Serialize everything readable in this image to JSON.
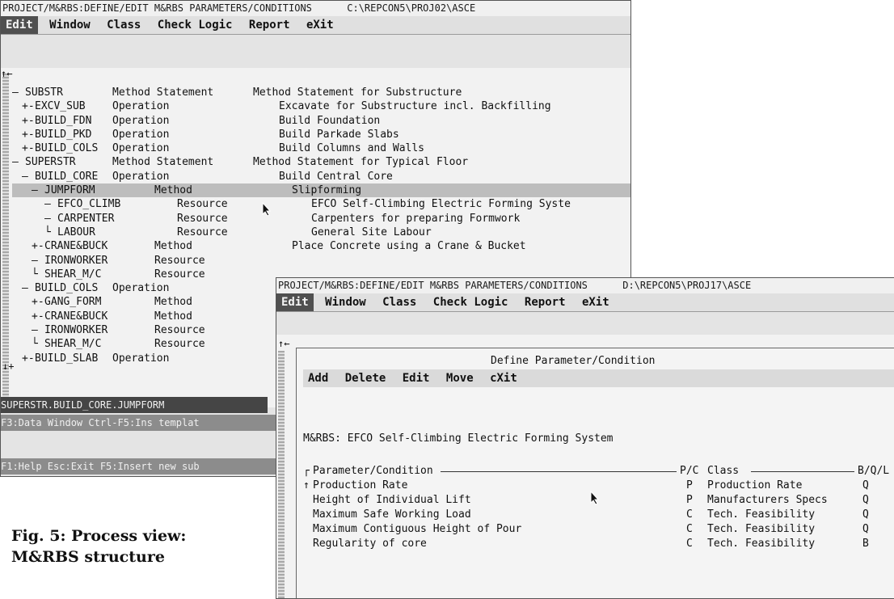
{
  "window1": {
    "title": "PROJECT/M&RBS:DEFINE/EDIT M&RBS PARAMETERS/CONDITIONS      C:\\REPCON5\\PROJ02\\ASCE",
    "menu": [
      "Edit",
      "Window",
      "Class",
      "Check Logic",
      "Report",
      "eXit"
    ],
    "tree_marker": "↑←",
    "tree_rows": [
      {
        "prefix": "—",
        "code": "SUBSTR",
        "type": "Method Statement",
        "desc": "Method Statement for Substructure",
        "indent": 0
      },
      {
        "prefix": "+-",
        "code": "EXCV_SUB",
        "type": "Operation",
        "desc": "Excavate for Substructure incl. Backfilling",
        "indent": 1
      },
      {
        "prefix": "+-",
        "code": "BUILD_FDN",
        "type": "Operation",
        "desc": "Build Foundation",
        "indent": 1
      },
      {
        "prefix": "+-",
        "code": "BUILD_PKD",
        "type": "Operation",
        "desc": "Build Parkade Slabs",
        "indent": 1
      },
      {
        "prefix": "+-",
        "code": "BUILD_COLS",
        "type": "Operation",
        "desc": "Build Columns and Walls",
        "indent": 1
      },
      {
        "prefix": "—",
        "code": "SUPERSTR",
        "type": "Method Statement",
        "desc": "Method Statement for Typical Floor",
        "indent": 0
      },
      {
        "prefix": "—",
        "code": "BUILD_CORE",
        "type": "Operation",
        "desc": "Build Central Core",
        "indent": 1
      },
      {
        "prefix": "—",
        "code": "JUMPFORM",
        "type": "Method",
        "desc": "Slipforming",
        "indent": 2,
        "highlight": true
      },
      {
        "prefix": "—",
        "code": "EFCO_CLIMB",
        "type": "Resource",
        "desc": "EFCO Self-Climbing Electric Forming Syste",
        "indent": 3
      },
      {
        "prefix": "—",
        "code": "CARPENTER",
        "type": "Resource",
        "desc": "Carpenters for preparing Formwork",
        "indent": 3
      },
      {
        "prefix": "└",
        "code": "LABOUR",
        "type": "Resource",
        "desc": "General Site Labour",
        "indent": 3
      },
      {
        "prefix": "+-",
        "code": "CRANE&BUCK",
        "type": "Method",
        "desc": "Place Concrete using a Crane & Bucket",
        "indent": 2
      },
      {
        "prefix": "—",
        "code": "IRONWORKER",
        "type": "Resource",
        "desc": "",
        "indent": 2
      },
      {
        "prefix": "└",
        "code": "SHEAR_M/C",
        "type": "Resource",
        "desc": "",
        "indent": 2
      },
      {
        "prefix": "—",
        "code": "BUILD_COLS",
        "type": "Operation",
        "desc": "",
        "indent": 1
      },
      {
        "prefix": "+-",
        "code": "GANG_FORM",
        "type": "Method",
        "desc": "",
        "indent": 2
      },
      {
        "prefix": "+-",
        "code": "CRANE&BUCK",
        "type": "Method",
        "desc": "",
        "indent": 2
      },
      {
        "prefix": "—",
        "code": "IRONWORKER",
        "type": "Resource",
        "desc": "",
        "indent": 2
      },
      {
        "prefix": "└",
        "code": "SHEAR_M/C",
        "type": "Resource",
        "desc": "",
        "indent": 2
      },
      {
        "prefix": "+-",
        "code": "BUILD_SLAB",
        "type": "Operation",
        "desc": "",
        "indent": 1
      }
    ],
    "bottom_marker": "↓+",
    "status_path": "SUPERSTR.BUILD_CORE.JUMPFORM",
    "hint_line": "F3:Data Window Ctrl-F5:Ins templat",
    "key_line": "F1:Help Esc:Exit F5:Insert new sub"
  },
  "window2": {
    "title": "PROJECT/M&RBS:DEFINE/EDIT M&RBS PARAMETERS/CONDITIONS      D:\\REPCON5\\PROJ17\\ASCE",
    "menu": [
      "Edit",
      "Window",
      "Class",
      "Check Logic",
      "Report",
      "eXit"
    ],
    "tree_marker": "↑←",
    "dialog": {
      "title": "Define Parameter/Condition",
      "menu": [
        "Add",
        "Delete",
        "Edit",
        "Move",
        "cXit"
      ],
      "mrbs_line": "M&RBS: EFCO Self-Climbing Electric Forming System",
      "headers": {
        "param": "Parameter/Condition",
        "pc": "P/C",
        "class": "Class",
        "bql": "B/Q/L"
      },
      "rows": [
        {
          "param": "Production Rate",
          "pc": "P",
          "class": "Production Rate",
          "bql": "Q"
        },
        {
          "param": "Height of Individual Lift",
          "pc": "P",
          "class": "Manufacturers Specs",
          "bql": "Q"
        },
        {
          "param": "Maximum Safe Working Load",
          "pc": "C",
          "class": "Tech. Feasibility",
          "bql": "Q"
        },
        {
          "param": "Maximum Contiguous Height of Pour",
          "pc": "C",
          "class": "Tech. Feasibility",
          "bql": "Q"
        },
        {
          "param": "Regularity of core",
          "pc": "C",
          "class": "Tech. Feasibility",
          "bql": "B"
        }
      ]
    }
  },
  "caption": {
    "line1": "Fig. 5: Process view:",
    "line2": "M&RBS structure"
  }
}
